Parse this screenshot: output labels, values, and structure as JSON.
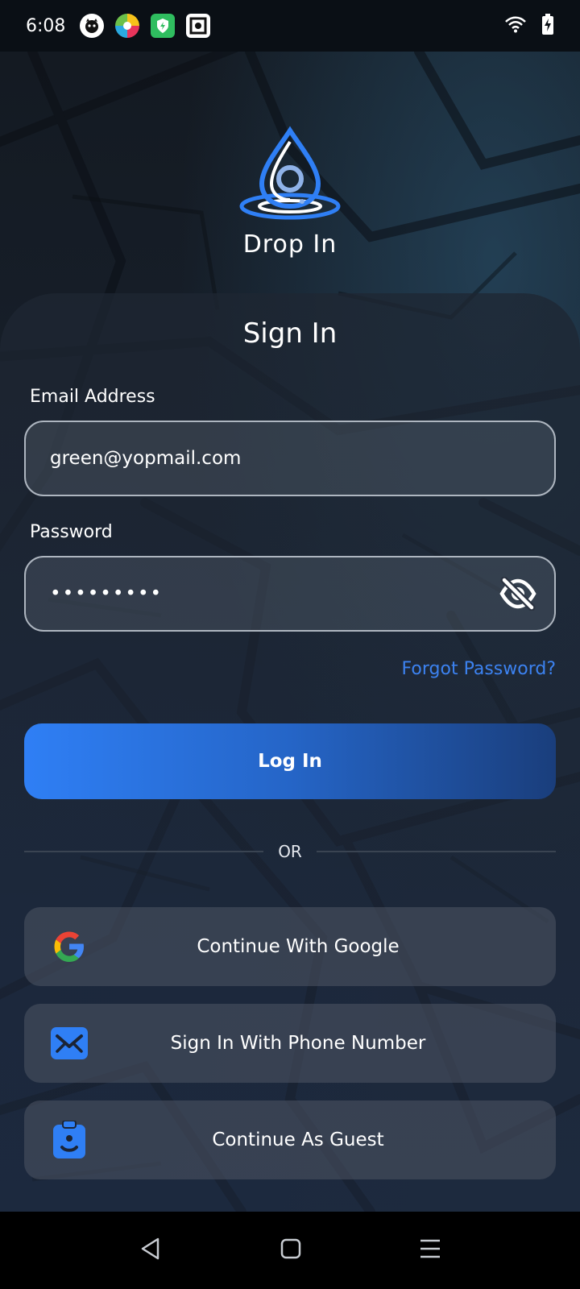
{
  "status": {
    "time": "6:08"
  },
  "app": {
    "name": "Drop In"
  },
  "form": {
    "title": "Sign In",
    "email_label": "Email Address",
    "email_value": "green@yopmail.com",
    "password_label": "Password",
    "password_value": "•••••••••",
    "forgot_label": "Forgot Password?",
    "login_label": "Log In",
    "or_label": "OR"
  },
  "alt_buttons": {
    "google": "Continue With Google",
    "phone": "Sign In With Phone Number",
    "guest": "Continue As Guest"
  },
  "colors": {
    "accent": "#3c82f0",
    "button_start": "#2f7ff5",
    "button_end": "#1a3e7c"
  }
}
